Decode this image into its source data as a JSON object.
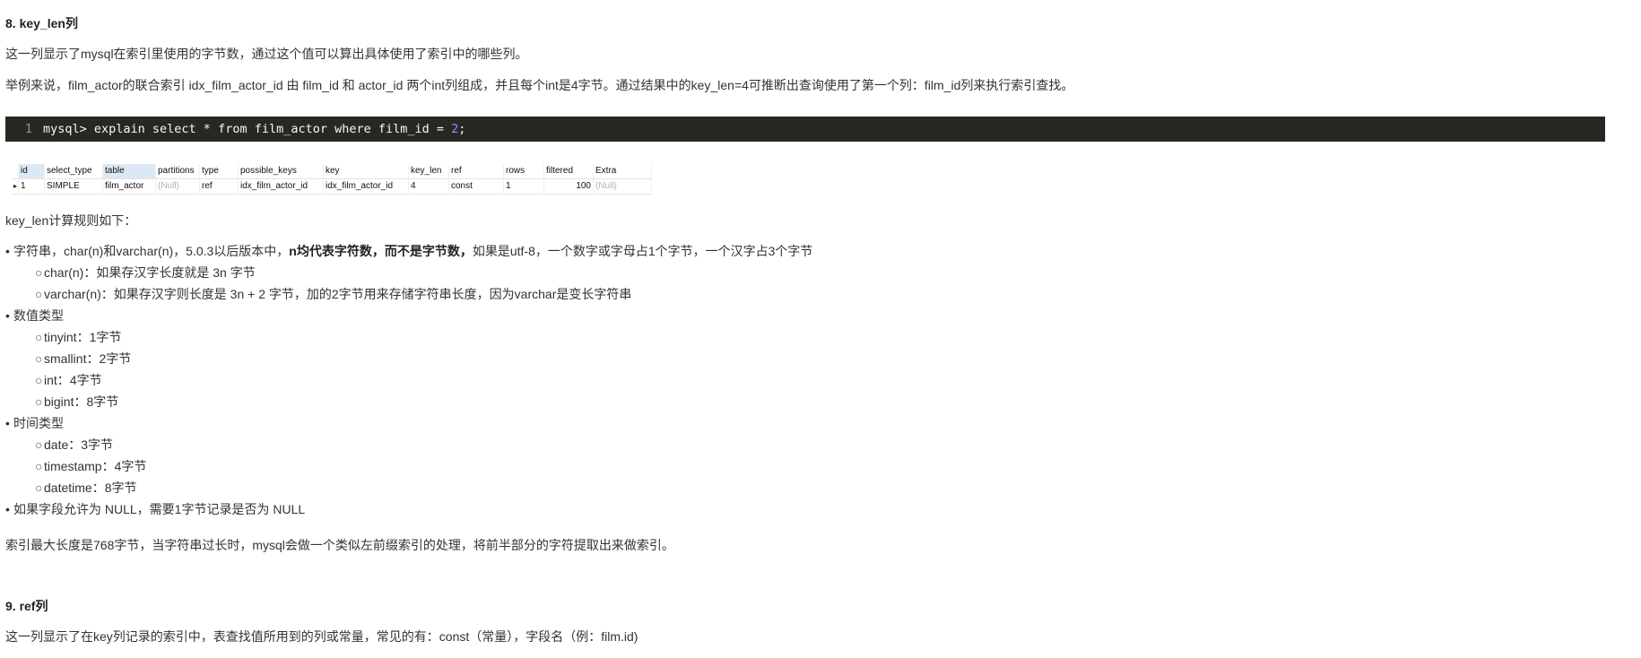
{
  "section8": {
    "title": "8. key_len列",
    "p1": "这一列显示了mysql在索引里使用的字节数，通过这个值可以算出具体使用了索引中的哪些列。",
    "p2": "举例来说，film_actor的联合索引 idx_film_actor_id 由 film_id 和 actor_id 两个int列组成，并且每个int是4字节。通过结果中的key_len=4可推断出查询使用了第一个列：film_id列来执行索引查找。"
  },
  "code": {
    "line_no": "1",
    "text": "mysql> explain select * from film_actor where film_id = ",
    "number": "2",
    "tail": ";"
  },
  "result_table": {
    "headers": [
      "id",
      "select_type",
      "table",
      "partitions",
      "type",
      "possible_keys",
      "key",
      "key_len",
      "ref",
      "rows",
      "filtered",
      "Extra"
    ],
    "row": [
      "1",
      "SIMPLE",
      "film_actor",
      "(Null)",
      "ref",
      "idx_film_actor_id",
      "idx_film_actor_id",
      "4",
      "const",
      "1",
      "100",
      "(Null)"
    ],
    "row_marker": "▸"
  },
  "rules_intro": "key_len计算规则如下：",
  "rules": {
    "bullet": "•",
    "sub_bullet": "○",
    "string": {
      "lead": "字符串，char(n)和varchar(n)，5.0.3以后版本中，",
      "bold": "n均代表字符数，而不是字节数，",
      "tail": "如果是utf-8，一个数字或字母占1个字节，一个汉字占3个字节",
      "sub": [
        "char(n)：如果存汉字长度就是 3n 字节",
        "varchar(n)：如果存汉字则长度是 3n + 2 字节，加的2字节用来存储字符串长度，因为varchar是变长字符串"
      ]
    },
    "numeric": {
      "label": "数值类型",
      "sub": [
        "tinyint：1字节",
        "smallint：2字节",
        "int：4字节",
        "bigint：8字节"
      ]
    },
    "time": {
      "label": "时间类型",
      "sub": [
        "date：3字节",
        "timestamp：4字节",
        "datetime：8字节"
      ]
    },
    "nullable": "如果字段允许为 NULL，需要1字节记录是否为 NULL"
  },
  "max_len_note": "索引最大长度是768字节，当字符串过长时，mysql会做一个类似左前缀索引的处理，将前半部分的字符提取出来做索引。",
  "section9": {
    "title": "9. ref列",
    "p1": "这一列显示了在key列记录的索引中，表查找值所用到的列或常量，常见的有：const（常量），字段名（例：film.id)"
  }
}
